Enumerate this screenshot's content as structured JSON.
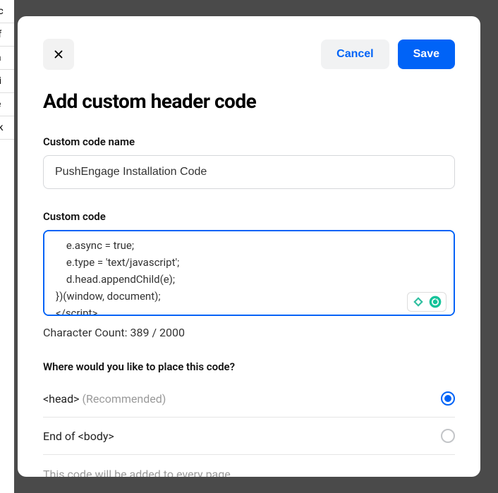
{
  "header": {
    "cancel_label": "Cancel",
    "save_label": "Save"
  },
  "modal": {
    "title": "Add custom header code"
  },
  "fields": {
    "name_label": "Custom code name",
    "name_value": "PushEngage Installation Code",
    "code_label": "Custom code",
    "code_value": "    e.async = true;\n    e.type = 'text/javascript';\n    d.head.appendChild(e);\n})(window, document);\n</scr|ipt>",
    "char_count_text": "Character Count: 389 / 2000"
  },
  "placement": {
    "question": "Where would you like to place this code?",
    "options": [
      {
        "label_main": "<head>",
        "label_hint": " (Recommended)",
        "selected": true
      },
      {
        "label_main": "End of <body>",
        "label_hint": "",
        "selected": false
      }
    ],
    "note": "This code will be added to every page."
  }
}
